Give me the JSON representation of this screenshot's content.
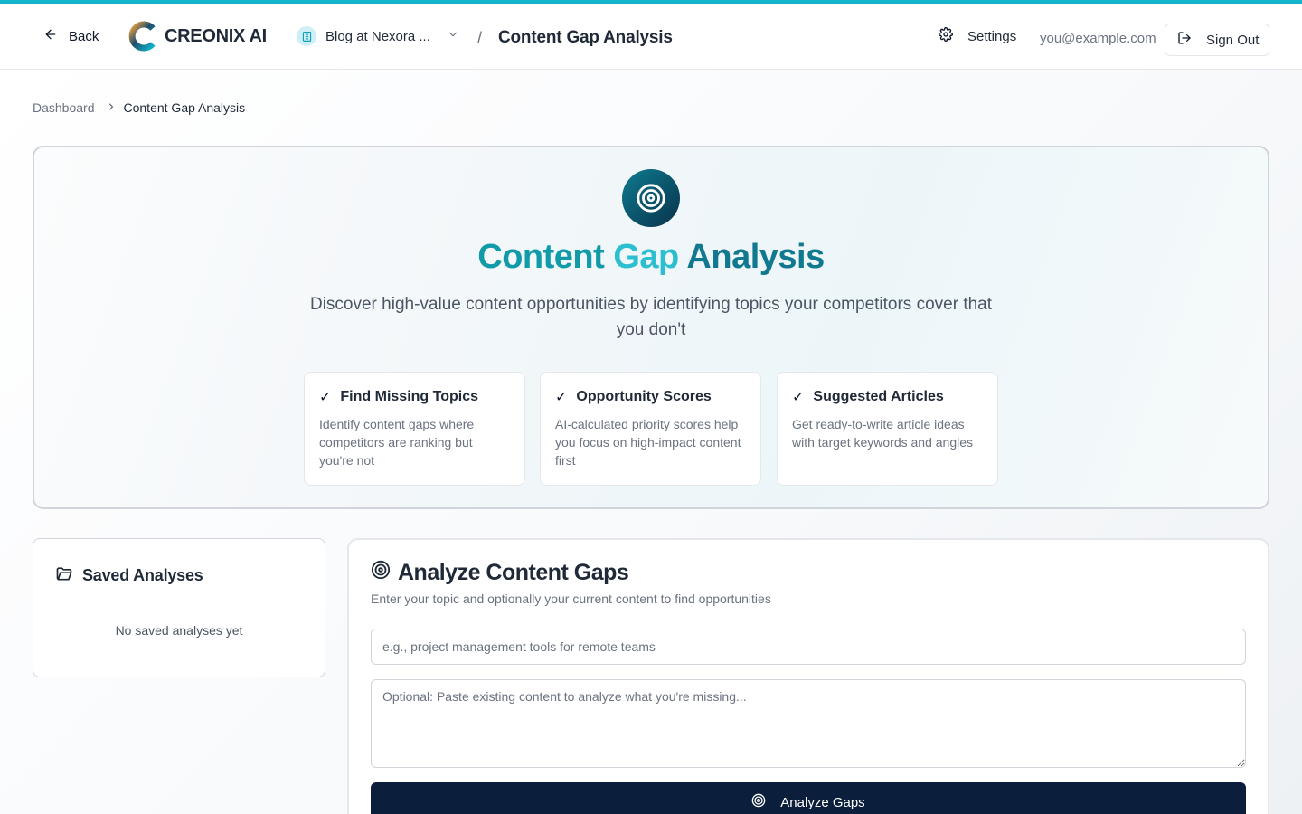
{
  "app": {
    "name": "CREONIX AI",
    "accent_color": "#12b5cc",
    "primary_button_color": "#0b1e3b"
  },
  "header": {
    "back_label": "Back",
    "site_selector": {
      "selected": "Blog at Nexora ...",
      "icon": "building-icon"
    },
    "separator": "/",
    "page_title": "Content Gap Analysis",
    "settings_label": "Settings",
    "user_email": "you@example.com",
    "sign_out_label": "Sign Out"
  },
  "breadcrumb": {
    "items": [
      {
        "label": "Dashboard"
      },
      {
        "label": "Content Gap Analysis"
      }
    ]
  },
  "hero": {
    "icon": "target-icon",
    "title_parts": [
      "Content",
      "Gap",
      "Analysis"
    ],
    "subtitle": "Discover high-value content opportunities by identifying topics your competitors cover that you don't",
    "features": [
      {
        "check": "✓",
        "title": "Find Missing Topics",
        "description": "Identify content gaps where competitors are ranking but you're not"
      },
      {
        "check": "✓",
        "title": "Opportunity Scores",
        "description": "AI-calculated priority scores help you focus on high-impact content first"
      },
      {
        "check": "✓",
        "title": "Suggested Articles",
        "description": "Get ready-to-write article ideas with target keywords and angles"
      }
    ]
  },
  "saved_analyses": {
    "title": "Saved Analyses",
    "empty_text": "No saved analyses yet"
  },
  "analyze": {
    "title": "Analyze Content Gaps",
    "subtitle": "Enter your topic and optionally your current content to find opportunities",
    "topic_placeholder": "e.g., project management tools for remote teams",
    "topic_value": "",
    "content_placeholder": "Optional: Paste existing content to analyze what you're missing...",
    "content_value": "",
    "button_label": "Analyze Gaps"
  }
}
